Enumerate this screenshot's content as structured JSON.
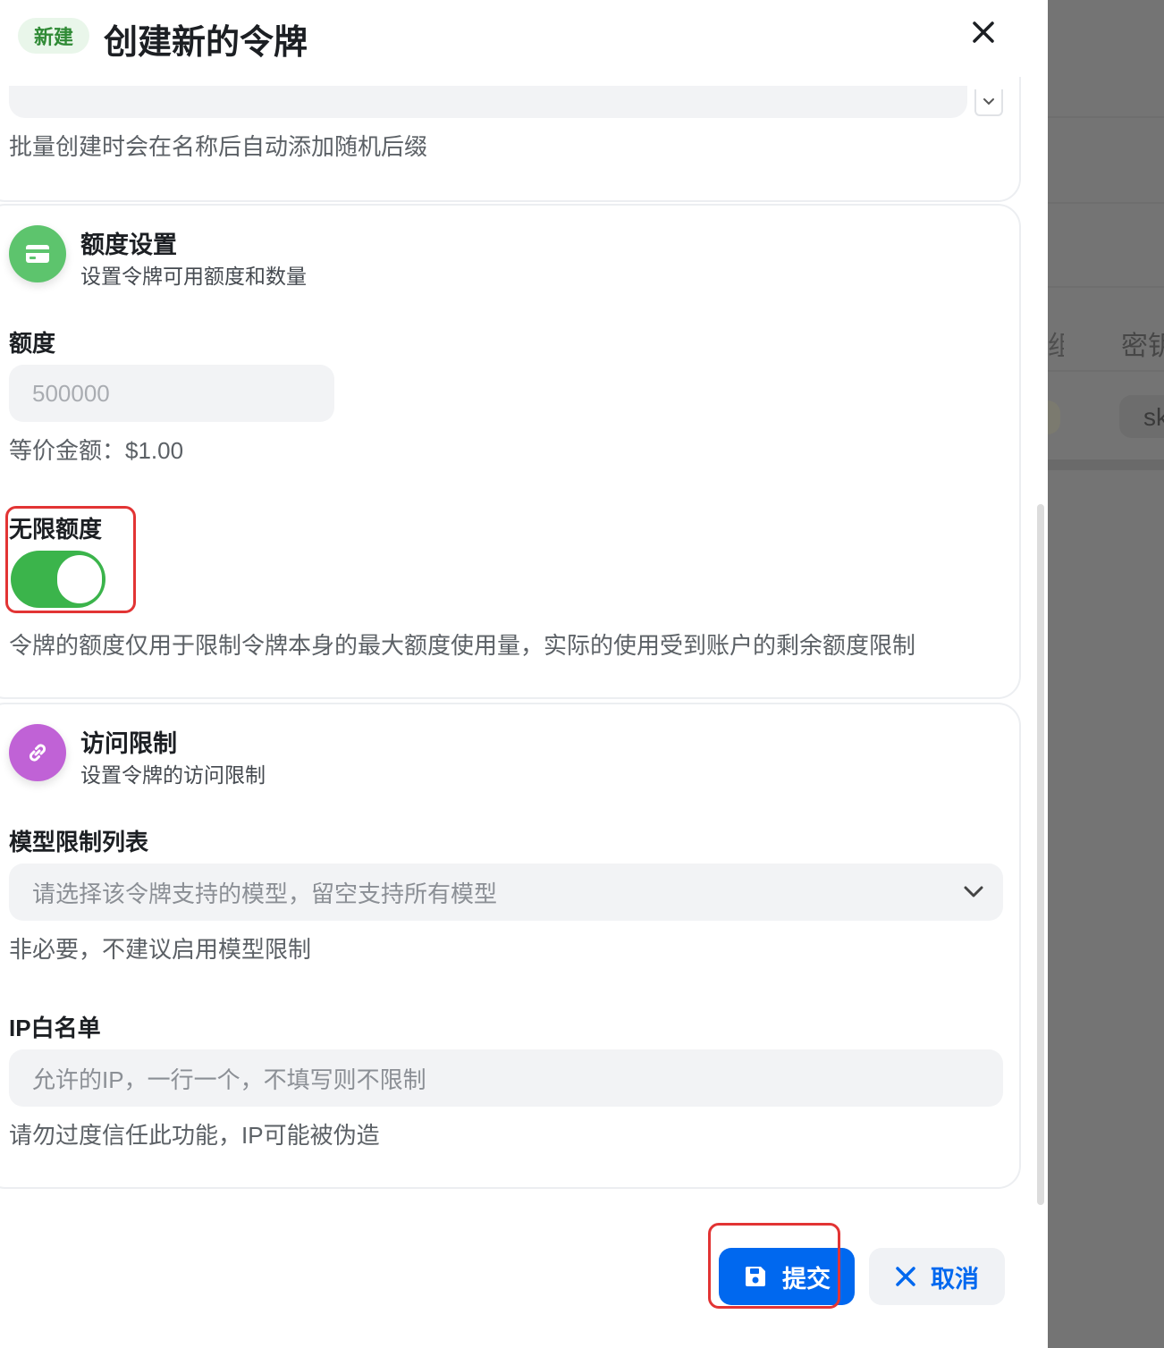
{
  "header": {
    "badge": "新建",
    "title": "创建新的令牌"
  },
  "name_section": {
    "help": "批量创建时会在名称后自动添加随机后缀"
  },
  "quota_section": {
    "title": "额度设置",
    "subtitle": "设置令牌可用额度和数量",
    "quota_label": "额度",
    "quota_value": "500000",
    "equivalent": "等价金额：$1.00",
    "unlimited_label": "无限额度",
    "unlimited_enabled": true,
    "unlimited_help": "令牌的额度仅用于限制令牌本身的最大额度使用量，实际的使用受到账户的剩余额度限制"
  },
  "access_section": {
    "title": "访问限制",
    "subtitle": "设置令牌的访问限制",
    "models_label": "模型限制列表",
    "models_placeholder": "请选择该令牌支持的模型，留空支持所有模型",
    "models_help": "非必要，不建议启用模型限制",
    "ip_label": "IP白名单",
    "ip_placeholder": "允许的IP，一行一个，不填写则不限制",
    "ip_help": "请勿过度信任此功能，IP可能被伪造"
  },
  "footer": {
    "submit_label": "提交",
    "cancel_label": "取消"
  },
  "backdrop": {
    "column_partial": "组",
    "column_key": "密钥",
    "key_prefix": "sk"
  },
  "colors": {
    "primary": "#0068ef",
    "toggle_on": "#3bb44b",
    "quota_icon": "#5dc46d",
    "access_icon": "#c062d6",
    "badge_bg": "#e9f6ea",
    "badge_text": "#2f8a35",
    "highlight": "#e23434"
  },
  "icons": {
    "close": "close-icon",
    "quota": "credit-card-icon",
    "access": "link-icon",
    "submit": "save-icon",
    "cancel": "close-icon",
    "select": "chevron-down-icon"
  }
}
